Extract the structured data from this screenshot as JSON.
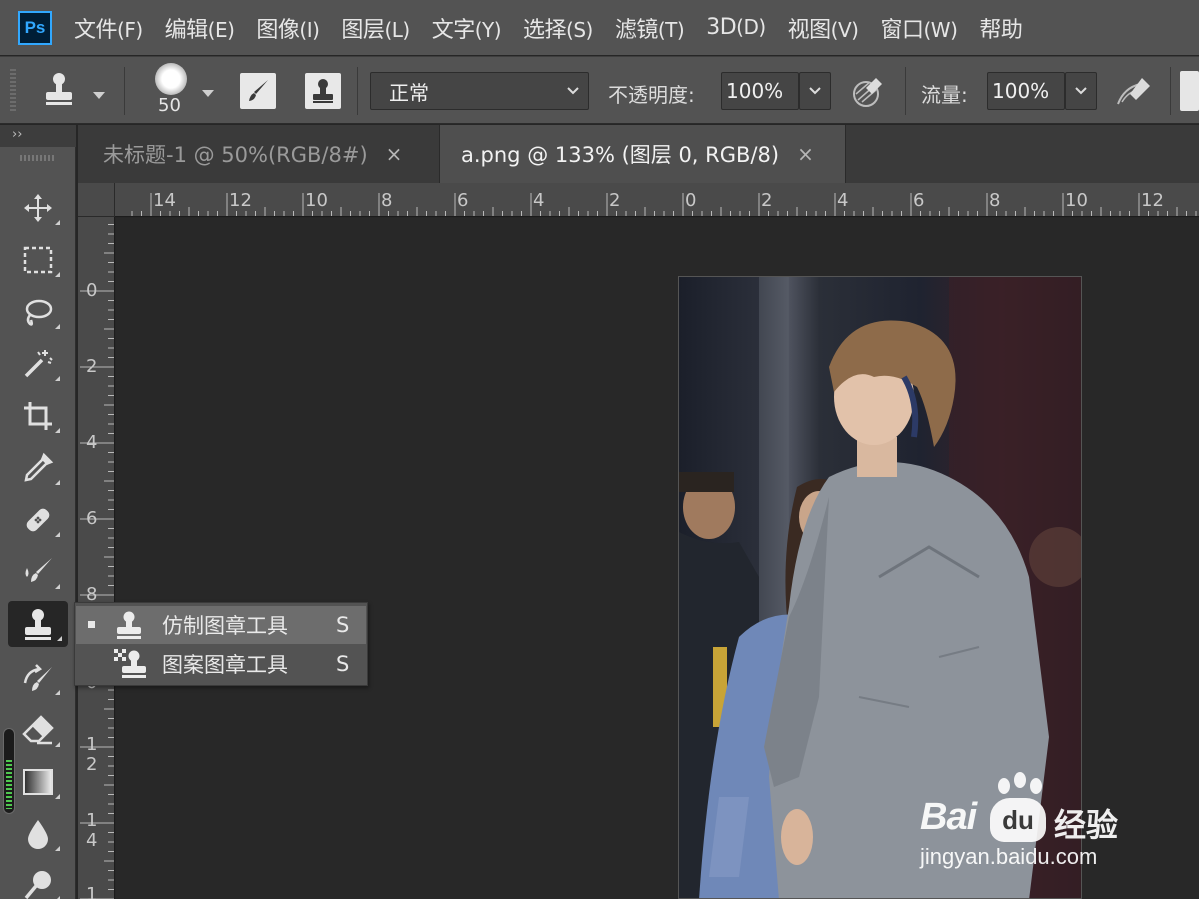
{
  "menubar": {
    "logo": "Ps",
    "items": [
      {
        "label": "文件",
        "accel": "(F)"
      },
      {
        "label": "编辑",
        "accel": "(E)"
      },
      {
        "label": "图像",
        "accel": "(I)"
      },
      {
        "label": "图层",
        "accel": "(L)"
      },
      {
        "label": "文字",
        "accel": "(Y)"
      },
      {
        "label": "选择",
        "accel": "(S)"
      },
      {
        "label": "滤镜",
        "accel": "(T)"
      },
      {
        "label": "3D",
        "accel": "(D)"
      },
      {
        "label": "视图",
        "accel": "(V)"
      },
      {
        "label": "窗口",
        "accel": "(W)"
      },
      {
        "label": "帮助",
        "accel": ""
      }
    ]
  },
  "options": {
    "brush_size": "50",
    "blend_mode": "正常",
    "opacity_label": "不透明度:",
    "opacity_value": "100%",
    "flow_label": "流量:",
    "flow_value": "100%"
  },
  "toolbar": {
    "collapse_label": "››",
    "active_tool": "clone-stamp"
  },
  "tabs": [
    {
      "title": "未标题-1 @ 50%(RGB/8#)",
      "close": "×"
    },
    {
      "title": "a.png @ 133% (图层 0, RGB/8)",
      "close": "×"
    }
  ],
  "ruler": {
    "h_labels": [
      "14",
      "12",
      "10",
      "8",
      "6",
      "4",
      "2",
      "0",
      "2",
      "4",
      "6",
      "8",
      "10",
      "12"
    ],
    "v_labels": [
      "0",
      "2",
      "4",
      "6",
      "8",
      "0",
      "1\n2",
      "1\n4",
      "1"
    ]
  },
  "flyout": {
    "items": [
      {
        "label": "仿制图章工具",
        "shortcut": "S",
        "selected": true
      },
      {
        "label": "图案图章工具",
        "shortcut": "S",
        "selected": false
      }
    ]
  },
  "watermark": {
    "brand": "Bai",
    "brand_cn": "经验",
    "url": "jingyan.baidu.com"
  },
  "colors": {
    "accent": "#31a8ff",
    "panel": "#535353",
    "canvas": "#282828"
  }
}
